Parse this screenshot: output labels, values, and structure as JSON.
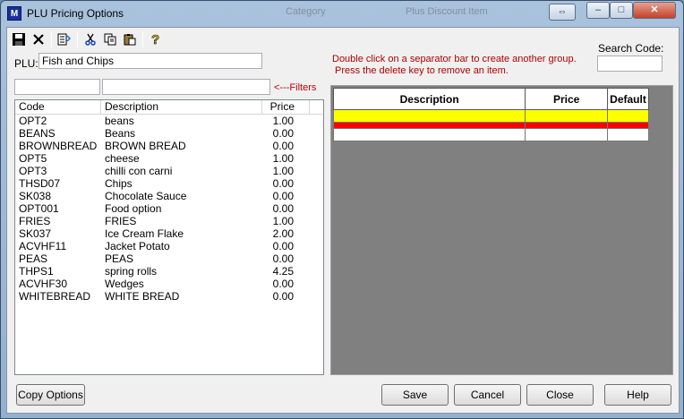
{
  "window": {
    "title": "PLU Pricing Options",
    "icon_text": "M",
    "background_ghost": [
      "Category",
      "Plus Discount Item"
    ]
  },
  "toolbar": {
    "items": [
      "save-icon",
      "delete-icon",
      "export-icon",
      "cut-icon",
      "copy-icon",
      "paste-icon",
      "help-icon"
    ]
  },
  "plu": {
    "label": "PLU:",
    "value": "Fish and Chips"
  },
  "hint": {
    "line1": "Double click on a separator bar to create another group.",
    "line2": "Press the delete key to remove an item."
  },
  "search": {
    "label": "Search Code:",
    "value": ""
  },
  "filters": {
    "link": "<---Filters",
    "code_value": "",
    "desc_value": ""
  },
  "list": {
    "columns": [
      "Code",
      "Description",
      "Price"
    ],
    "rows": [
      [
        "OPT2",
        "beans",
        "1.00"
      ],
      [
        "BEANS",
        "Beans",
        "0.00"
      ],
      [
        "BROWNBREAD",
        "BROWN BREAD",
        "0.00"
      ],
      [
        "OPT5",
        "cheese",
        "1.00"
      ],
      [
        "OPT3",
        "chilli con carni",
        "1.00"
      ],
      [
        "THSD07",
        "Chips",
        "0.00"
      ],
      [
        "SK038",
        "Chocolate Sauce",
        "0.00"
      ],
      [
        "OPT001",
        "Food option",
        "0.00"
      ],
      [
        "FRIES",
        "FRIES",
        "1.00"
      ],
      [
        "SK037",
        "Ice Cream Flake",
        "2.00"
      ],
      [
        "ACVHF11",
        "Jacket Potato",
        "0.00"
      ],
      [
        "PEAS",
        "PEAS",
        "0.00"
      ],
      [
        "THPS1",
        "spring rolls",
        "4.25"
      ],
      [
        "ACVHF30",
        "Wedges",
        "0.00"
      ],
      [
        "WHITEBREAD",
        "WHITE BREAD",
        "0.00"
      ]
    ]
  },
  "grid": {
    "columns": [
      "Description",
      "Price",
      "Default"
    ],
    "colors": {
      "selected_row": "#ffff00",
      "separator": "#ff0000"
    }
  },
  "buttons": {
    "copy_options": "Copy Options",
    "save": "Save",
    "cancel": "Cancel",
    "close": "Close",
    "help": "Help"
  }
}
